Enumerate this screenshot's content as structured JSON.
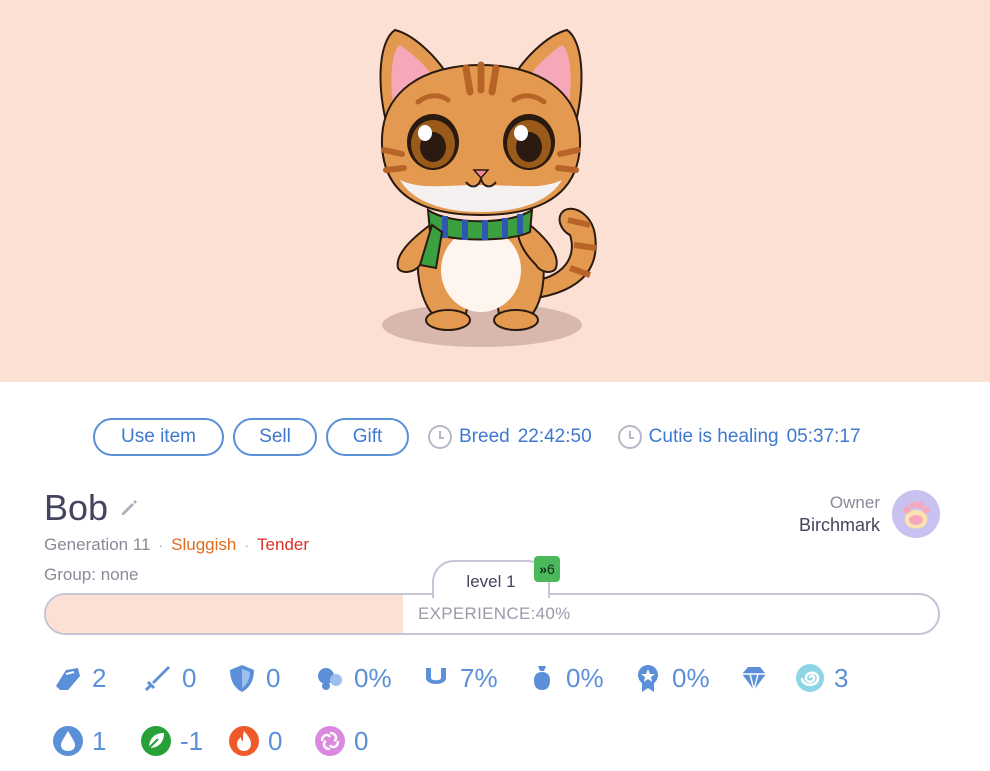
{
  "actions": {
    "use_item": "Use item",
    "sell": "Sell",
    "gift": "Gift"
  },
  "timers": {
    "breed_label": "Breed",
    "breed_time": "22:42:50",
    "healing_label": "Cutie is healing",
    "healing_time": "05:37:17"
  },
  "cutie": {
    "name": "Bob",
    "generation": "Generation 11",
    "trait1": "Sluggish",
    "trait2": "Tender",
    "group": "Group: none"
  },
  "owner": {
    "label": "Owner",
    "name": "Birchmark"
  },
  "level": {
    "label": "level 1",
    "boost": "6",
    "experience_text": "EXPERIENCE:40%",
    "experience_fraction": 0.4
  },
  "stats_row1": [
    {
      "icon": "attack-icon",
      "value": "2"
    },
    {
      "icon": "sword-icon",
      "value": "0"
    },
    {
      "icon": "shield-icon",
      "value": "0"
    },
    {
      "icon": "dodge-icon",
      "value": "0%"
    },
    {
      "icon": "horseshoe-icon",
      "value": "7%"
    },
    {
      "icon": "money-bag-icon",
      "value": "0%"
    },
    {
      "icon": "medal-icon",
      "value": "0%"
    },
    {
      "icon": "diamond-icon",
      "value": ""
    },
    {
      "icon": "spiral-icon",
      "value": "3"
    }
  ],
  "stats_row2": [
    {
      "icon": "water-icon",
      "value": "1"
    },
    {
      "icon": "nature-icon",
      "value": "-1"
    },
    {
      "icon": "fire-icon",
      "value": "0"
    },
    {
      "icon": "vortex-icon",
      "value": "0"
    }
  ],
  "colors": {
    "hero_bg": "#fde0d4",
    "accent": "#5b8fd8",
    "sluggish": "#e06a1e",
    "tender": "#d9322a"
  }
}
